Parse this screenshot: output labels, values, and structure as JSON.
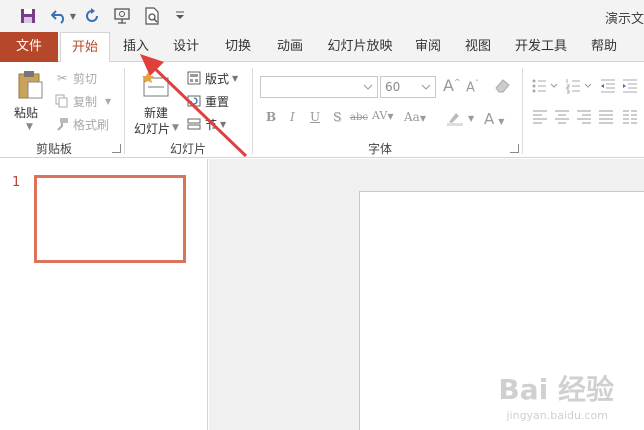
{
  "window": {
    "title": "演示文"
  },
  "qat": {
    "icons": [
      "save-icon",
      "undo-icon",
      "redo-icon",
      "present-from-start-icon",
      "print-preview-icon",
      "customize-qat-icon"
    ]
  },
  "tabs": [
    {
      "label": "文件"
    },
    {
      "label": "开始"
    },
    {
      "label": "插入"
    },
    {
      "label": "设计"
    },
    {
      "label": "切换"
    },
    {
      "label": "动画"
    },
    {
      "label": "幻灯片放映"
    },
    {
      "label": "审阅"
    },
    {
      "label": "视图"
    },
    {
      "label": "开发工具"
    },
    {
      "label": "帮助"
    }
  ],
  "clipboard": {
    "label": "剪贴板",
    "paste": "粘贴",
    "cut": "剪切",
    "copy": "复制",
    "format_painter": "格式刷"
  },
  "slides_group": {
    "label": "幻灯片",
    "new_slide_line1": "新建",
    "new_slide_line2": "幻灯片",
    "layout": "版式",
    "reset": "重置",
    "section": "节"
  },
  "font_group": {
    "label": "字体",
    "font_name": "",
    "font_size": "60",
    "bold": "B",
    "italic": "I",
    "underline": "U",
    "shadow": "S",
    "strikethrough": "abc",
    "spacing": "AV",
    "change_case": "Aa",
    "font_color": "A",
    "grow": "A",
    "shrink": "A"
  },
  "slide_panel": {
    "slide_number": "1"
  },
  "watermark": {
    "text": "Bai 经验",
    "sub": "jingyan.baidu.com"
  },
  "colors": {
    "accent": "#b7472a",
    "thumb_border": "#d9735a",
    "arrow": "#e0403c"
  }
}
